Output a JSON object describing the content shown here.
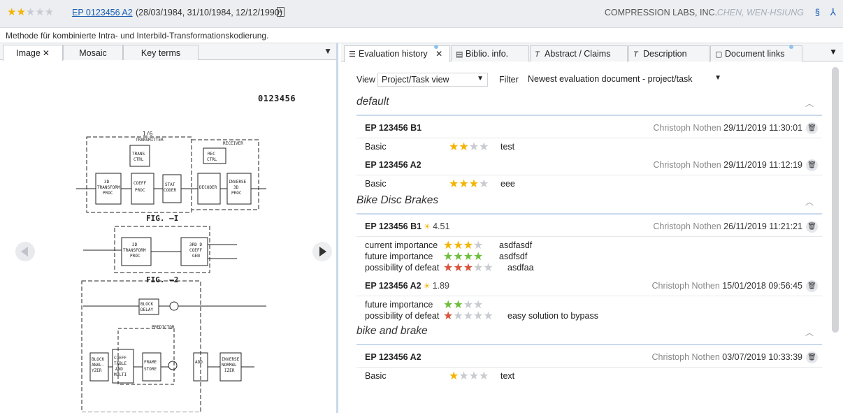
{
  "header": {
    "stars_on": "★★",
    "stars_off": "★★★",
    "publication": "EP 0123456 A2",
    "dates": "(28/03/1984, 31/10/1984, 12/12/1990)",
    "applicant": "COMPRESSION LABS, INC.",
    "inventor": "CHEN, WEN-HSIUNG",
    "title": "Methode für kombinierte Intra- und Interbild-Transformationskodierung."
  },
  "left_tabs": [
    {
      "label": "Image"
    },
    {
      "label": "Mosaic"
    },
    {
      "label": "Key terms"
    }
  ],
  "viewer": {
    "doc_number": "0123456"
  },
  "right_tabs": [
    {
      "label": "Evaluation history"
    },
    {
      "label": "Biblio. info."
    },
    {
      "label": "Abstract / Claims"
    },
    {
      "label": "Description"
    },
    {
      "label": "Document links"
    }
  ],
  "filters": {
    "view_label": "View",
    "view_value": "Project/Task view",
    "filter_label": "Filter",
    "filter_value": "Newest evaluation document - project/task"
  },
  "groups": [
    {
      "title": "default",
      "evaluations": [
        {
          "doc": "EP 123456 B1",
          "author": "Christoph Nothen",
          "time": "29/11/2019 11:30:01",
          "criteria": [
            {
              "name": "Basic",
              "rating": 2,
              "max": 4,
              "color": "#f4b400",
              "note": "test"
            }
          ]
        },
        {
          "doc": "EP 123456 A2",
          "author": "Christoph Nothen",
          "time": "29/11/2019 11:12:19",
          "criteria": [
            {
              "name": "Basic",
              "rating": 3,
              "max": 4,
              "color": "#f4b400",
              "note": "eee"
            }
          ]
        }
      ]
    },
    {
      "title": "Bike Disc Brakes",
      "evaluations": [
        {
          "doc": "EP 123456 B1",
          "score": "4.51",
          "author": "Christoph Nothen",
          "time": "26/11/2019 11:21:21",
          "criteria": [
            {
              "name": "current importance",
              "rating": 3,
              "max": 4,
              "color": "#f4b400",
              "note": "asdfasdf"
            },
            {
              "name": "future importance",
              "rating": 4,
              "max": 4,
              "color": "#6cbf3a",
              "note": "asdfsdf"
            },
            {
              "name": "possibility of defeat",
              "rating": 3,
              "max": 5,
              "color": "#d9523a",
              "note": "asdfaa"
            }
          ]
        },
        {
          "doc": "EP 123456 A2",
          "score": "1.89",
          "author": "Christoph Nothen",
          "time": "15/01/2018 09:56:45",
          "criteria": [
            {
              "name": "future importance",
              "rating": 2,
              "max": 4,
              "color": "#6cbf3a",
              "note": ""
            },
            {
              "name": "possibility of defeat",
              "rating": 1,
              "max": 5,
              "color": "#d9523a",
              "note": "easy solution to bypass"
            }
          ]
        }
      ]
    },
    {
      "title": "bike and brake",
      "evaluations": [
        {
          "doc": "EP 123456 A2",
          "author": "Christoph Nothen",
          "time": "03/07/2019 10:33:39",
          "criteria": [
            {
              "name": "Basic",
              "rating": 1,
              "max": 4,
              "color": "#f4b400",
              "note": "text"
            }
          ]
        }
      ]
    }
  ],
  "drawing": {
    "labels": [
      "TRANSMITTER",
      "RECEIVER",
      "TRANS CTRL",
      "REC CTRL",
      "3D TRANSFORM PROC",
      "COEFF PROC",
      "STAT CODER",
      "DECODER",
      "INVERSE 3D PROC",
      "FIG. —I",
      "2D TRANSFORM PROC",
      "3RD D COEFF GEN",
      "FIG. —2",
      "BLOCK DELAY",
      "PREDICTOR",
      "FRAME STORE",
      "BLOCK ANALYZER",
      "COEFF TABLE AND MULTIPLIER",
      "INVERSE NORMALIZER",
      "ADD",
      "1/6"
    ]
  }
}
